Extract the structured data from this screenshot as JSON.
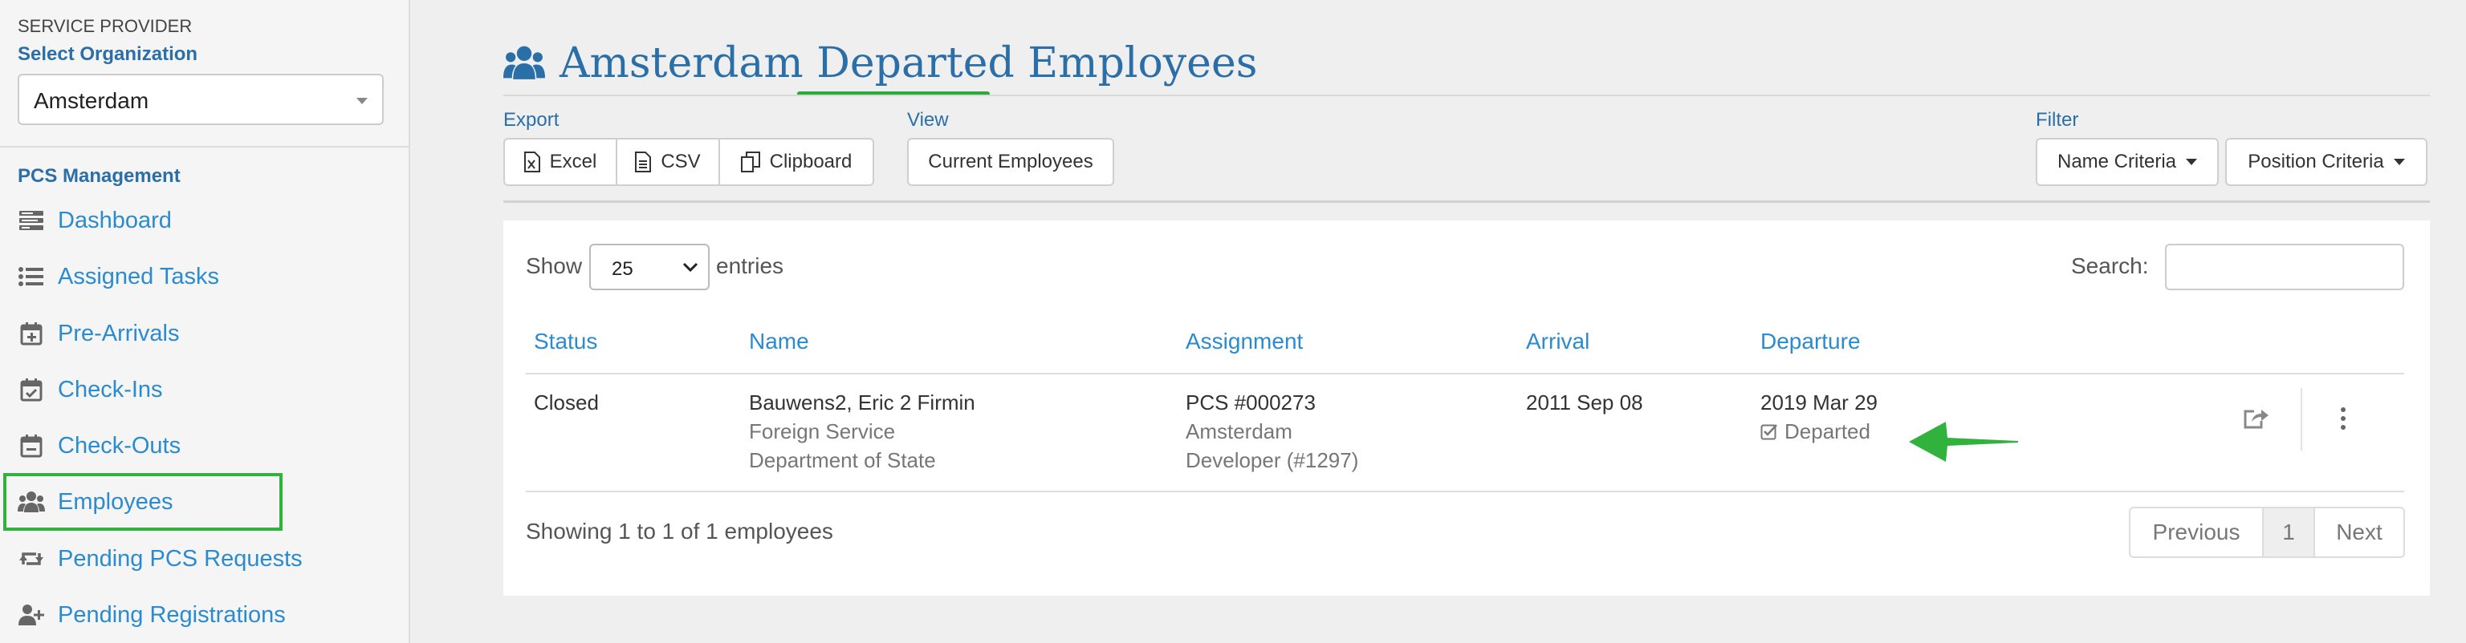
{
  "sidebar": {
    "service_provider_label": "SERVICE PROVIDER",
    "select_org_label": "Select Organization",
    "org_value": "Amsterdam",
    "section_title": "PCS Management",
    "items": [
      {
        "label": "Dashboard",
        "icon": "dashboard-icon"
      },
      {
        "label": "Assigned Tasks",
        "icon": "list-icon"
      },
      {
        "label": "Pre-Arrivals",
        "icon": "calendar-plus-icon"
      },
      {
        "label": "Check-Ins",
        "icon": "calendar-check-icon"
      },
      {
        "label": "Check-Outs",
        "icon": "calendar-minus-icon"
      },
      {
        "label": "Employees",
        "icon": "users-icon"
      },
      {
        "label": "Pending PCS Requests",
        "icon": "retweet-icon"
      },
      {
        "label": "Pending Registrations",
        "icon": "user-plus-icon"
      }
    ]
  },
  "header": {
    "title": "Amsterdam Departed Employees",
    "icon": "users-icon"
  },
  "toolbar": {
    "export_label": "Export",
    "excel_label": "Excel",
    "csv_label": "CSV",
    "clipboard_label": "Clipboard",
    "view_label": "View",
    "current_employees_label": "Current Employees",
    "filter_label": "Filter",
    "name_criteria_label": "Name Criteria",
    "position_criteria_label": "Position Criteria"
  },
  "table_controls": {
    "show_label": "Show",
    "entries_value": "25",
    "entries_label": "entries",
    "search_label": "Search:",
    "search_value": ""
  },
  "table": {
    "headers": [
      "Status",
      "Name",
      "Assignment",
      "Arrival",
      "Departure"
    ],
    "rows": [
      {
        "status": "Closed",
        "name": "Bauwens2, Eric 2 Firmin",
        "name_sub1": "Foreign Service",
        "name_sub2": "Department of State",
        "assignment": "PCS #000273",
        "assignment_sub1": "Amsterdam",
        "assignment_sub2": "Developer (#1297)",
        "arrival": "2011 Sep 08",
        "departure": "2019 Mar 29",
        "departure_status": "Departed"
      }
    ]
  },
  "footer": {
    "showing_text": "Showing 1 to 1 of 1 employees",
    "previous_label": "Previous",
    "page_number": "1",
    "next_label": "Next"
  },
  "colors": {
    "link_blue": "#2a8bd0",
    "title_blue": "#2a6fa8",
    "annotation_green": "#31b23d"
  }
}
